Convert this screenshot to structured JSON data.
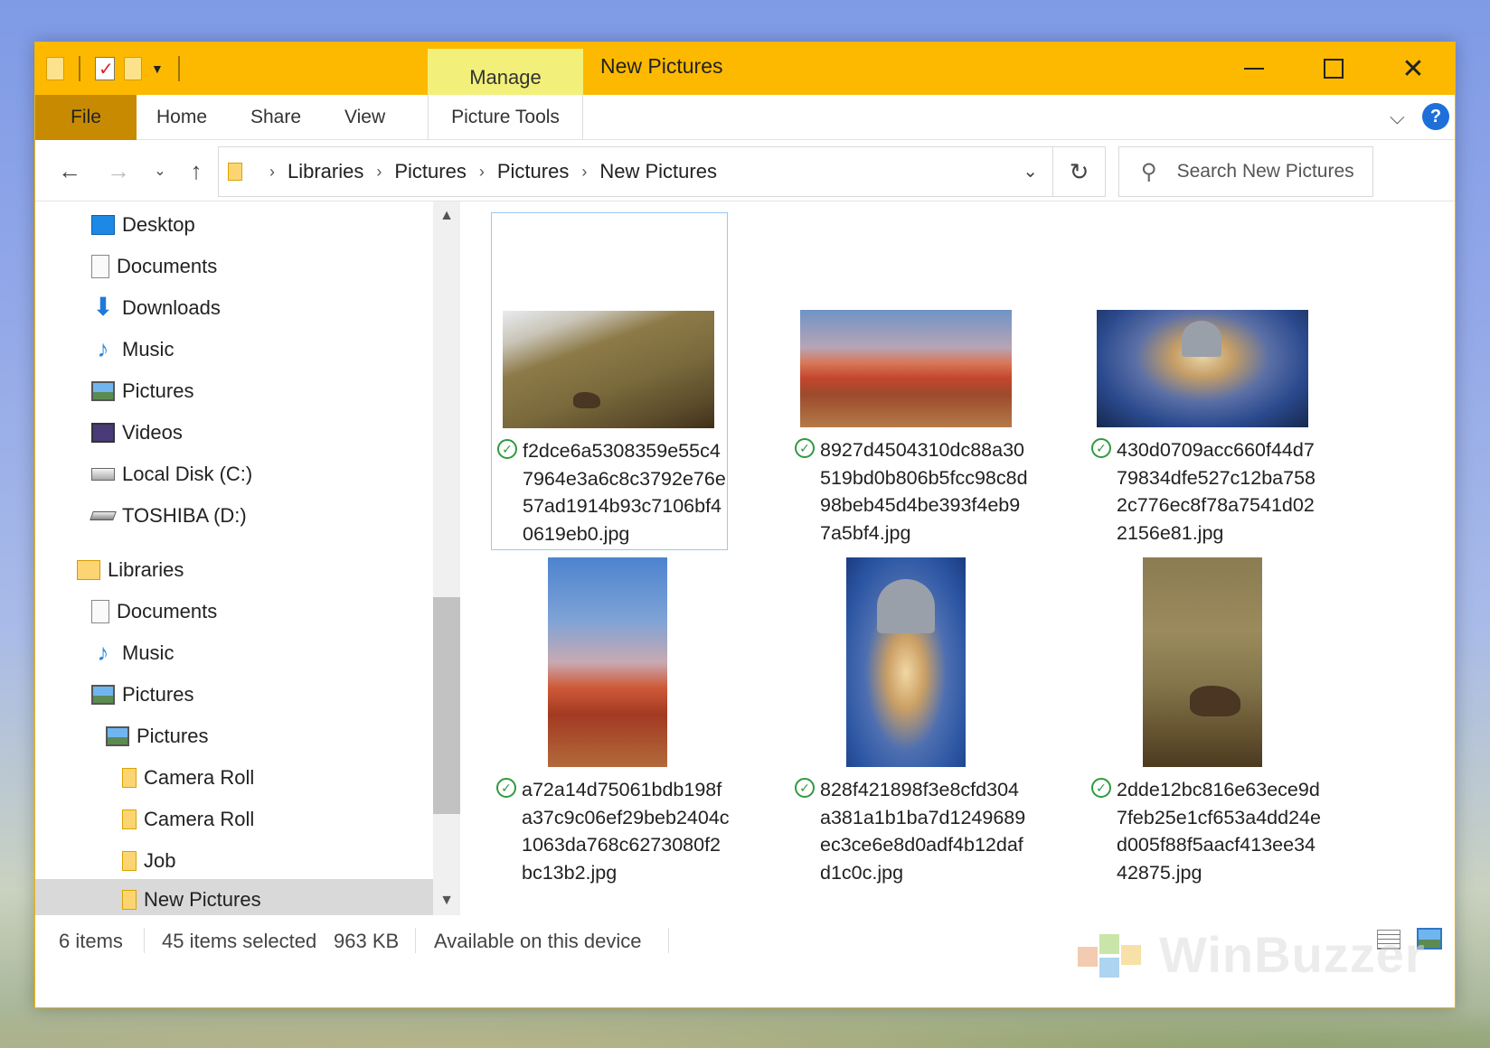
{
  "window": {
    "title": "New Pictures",
    "contextual_tab_group": "Manage"
  },
  "ribbon": {
    "tabs": [
      "File",
      "Home",
      "Share",
      "View",
      "Picture Tools"
    ],
    "help_label": "?"
  },
  "address": {
    "breadcrumbs": [
      "Libraries",
      "Pictures",
      "Pictures",
      "New Pictures"
    ]
  },
  "search": {
    "placeholder": "Search New Pictures"
  },
  "sidebar": {
    "items": [
      {
        "label": "Desktop",
        "icon": "desktop-icon"
      },
      {
        "label": "Documents",
        "icon": "documents-icon"
      },
      {
        "label": "Downloads",
        "icon": "downloads-icon"
      },
      {
        "label": "Music",
        "icon": "music-icon"
      },
      {
        "label": "Pictures",
        "icon": "pictures-icon"
      },
      {
        "label": "Videos",
        "icon": "videos-icon"
      },
      {
        "label": "Local Disk (C:)",
        "icon": "local-disk-icon"
      },
      {
        "label": "TOSHIBA (D:)",
        "icon": "usb-drive-icon"
      },
      {
        "label": "Libraries",
        "icon": "libraries-icon"
      },
      {
        "label": "Documents",
        "icon": "documents-icon"
      },
      {
        "label": "Music",
        "icon": "music-icon"
      },
      {
        "label": "Pictures",
        "icon": "pictures-icon"
      },
      {
        "label": "Pictures",
        "icon": "pictures-icon"
      },
      {
        "label": "Camera Roll",
        "icon": "folder-icon"
      },
      {
        "label": "Camera Roll",
        "icon": "folder-icon"
      },
      {
        "label": "Job",
        "icon": "folder-icon"
      },
      {
        "label": "New Pictures",
        "icon": "folder-icon",
        "selected": true
      }
    ]
  },
  "files": [
    {
      "name": "f2dce6a5308359e55c47964e3a6c8c3792e76e57ad1914b93c7106bf40619eb0.jpg",
      "selected": true
    },
    {
      "name": "8927d4504310dc88a30519bd0b806b5fcc98c8d98beb45d4be393f4eb97a5bf4.jpg"
    },
    {
      "name": "430d0709acc660f44d779834dfe527c12ba7582c776ec8f78a7541d022156e81.jpg"
    },
    {
      "name": "a72a14d75061bdb198fa37c9c06ef29beb2404c1063da768c6273080f2bc13b2.jpg"
    },
    {
      "name": "828f421898f3e8cfd304a381a1b1ba7d1249689ec3ce6e8d0adf4b12dafd1c0c.jpg"
    },
    {
      "name": "2dde12bc816e63ece9d7feb25e1cf653a4dd24ed005f88f5aacf413ee3442875.jpg"
    }
  ],
  "status": {
    "item_count": "6 items",
    "selected": "45 items selected",
    "size": "963 KB",
    "availability": "Available on this device"
  },
  "watermark": "WinBuzzer",
  "colors": {
    "titlebar": "#fdb900",
    "file_tab": "#c78a00",
    "manage_tab": "#f2f07a",
    "sync_ok": "#2f9a3e"
  }
}
